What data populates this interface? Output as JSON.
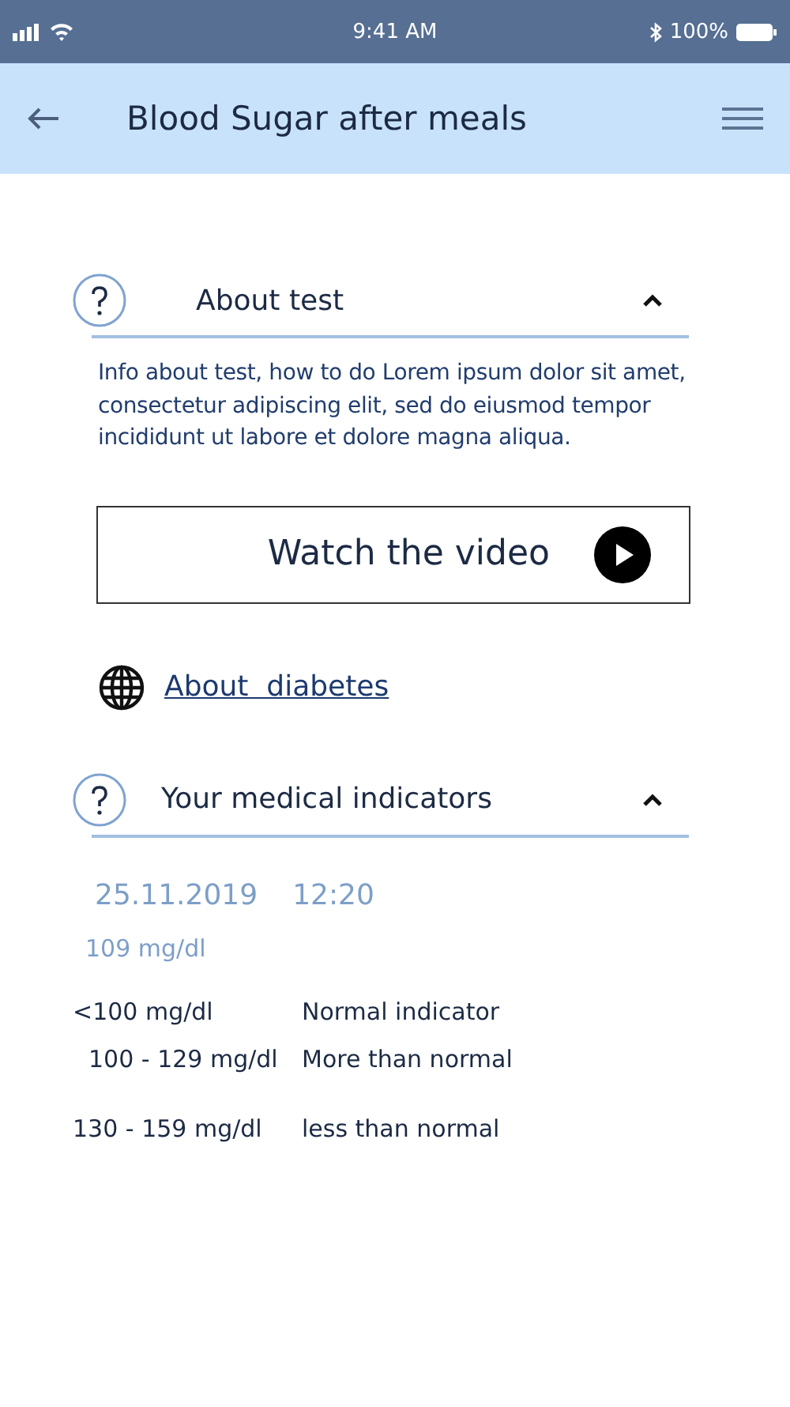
{
  "status_bar": {
    "time": "9:41 AM",
    "battery": "100%"
  },
  "header": {
    "title": "Blood Sugar after meals"
  },
  "about_section": {
    "title": "About test",
    "expanded": true,
    "text": "Info about test, how to do Lorem ipsum dolor sit amet, consectetur adipiscing elit, sed do eiusmod tempor incididunt ut labore et dolore magna aliqua.",
    "video_button": "Watch the video"
  },
  "link": "About  diabetes",
  "indicators_section": {
    "title": "Your medical indicators",
    "expanded": true,
    "date": "25.11.2019",
    "time": "12:20",
    "reading": "109 mg/dl",
    "ranges": [
      {
        "range": "<100 mg/dl",
        "meaning": "Normal indicator"
      },
      {
        "range": "100 - 129 mg/dl",
        "meaning": "More than normal"
      },
      {
        "range": "130 - 159 mg/dl",
        "meaning": "less than normal"
      }
    ]
  }
}
